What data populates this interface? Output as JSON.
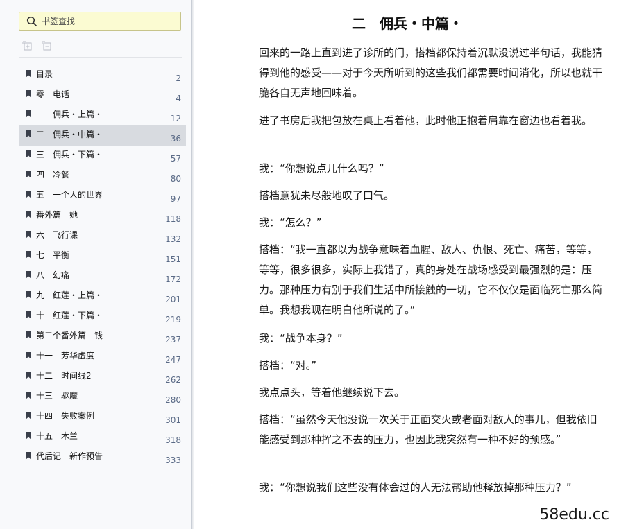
{
  "search": {
    "placeholder": "书签查找"
  },
  "toolbar": {
    "expand_icon": "expand-all-icon",
    "collapse_icon": "collapse-all-icon"
  },
  "bookmarks": [
    {
      "label": "目录",
      "page": "2"
    },
    {
      "label": "零　电话",
      "page": "4"
    },
    {
      "label": "一　佣兵・上篇・",
      "page": "12"
    },
    {
      "label": "二　佣兵・中篇・",
      "page": "36",
      "selected": true
    },
    {
      "label": "三　佣兵・下篇・",
      "page": "57"
    },
    {
      "label": "四　冷餐",
      "page": "80"
    },
    {
      "label": "五　一个人的世界",
      "page": "97"
    },
    {
      "label": "番外篇　她",
      "page": "118"
    },
    {
      "label": "六　飞行课",
      "page": "132"
    },
    {
      "label": "七　平衡",
      "page": "151"
    },
    {
      "label": "八　幻痛",
      "page": "172"
    },
    {
      "label": "九　红莲・上篇・",
      "page": "201"
    },
    {
      "label": "十　红莲・下篇・",
      "page": "219"
    },
    {
      "label": "第二个番外篇　钱",
      "page": "237"
    },
    {
      "label": "十一　芳华虚度",
      "page": "247"
    },
    {
      "label": "十二　时间线2",
      "page": "262"
    },
    {
      "label": "十三　驱魔",
      "page": "280"
    },
    {
      "label": "十四　失败案例",
      "page": "301"
    },
    {
      "label": "十五　木兰",
      "page": "318"
    },
    {
      "label": "代后记　新作预告",
      "page": "333"
    }
  ],
  "document": {
    "title": "二　佣兵・中篇・",
    "paragraphs": [
      "回来的一路上直到进了诊所的门，搭档都保持着沉默没说过半句话，我能猜得到他的感受——对于今天所听到的这些我们都需要时间消化，所以也就干脆各自无声地回味着。",
      "进了书房后我把包放在桌上看着他，此时他正抱着肩靠在窗边也看着我。",
      "我：“你想说点儿什么吗？”",
      "搭档意犹未尽般地叹了口气。",
      "我：“怎么？”",
      "搭档：“我一直都以为战争意味着血腥、敌人、仇恨、死亡、痛苦，等等，等等，很多很多，实际上我错了，真的身处在战场感受到最强烈的是：压力。那种压力有别于我们生活中所接触的一切，它不仅仅是面临死亡那么简单。我想我现在明白他所说的了。”",
      "我：“战争本身？”",
      "搭档：“对。”",
      "我点点头，等着他继续说下去。",
      "搭档：“虽然今天他没说一次关于正面交火或者面对敌人的事儿，但我依旧能感受到那种挥之不去的压力，也因此我突然有一种不好的预感。”",
      "我：“你想说我们这些没有体会过的人无法帮助他释放掉那种压力？”"
    ]
  },
  "watermark": "58edu.cc"
}
